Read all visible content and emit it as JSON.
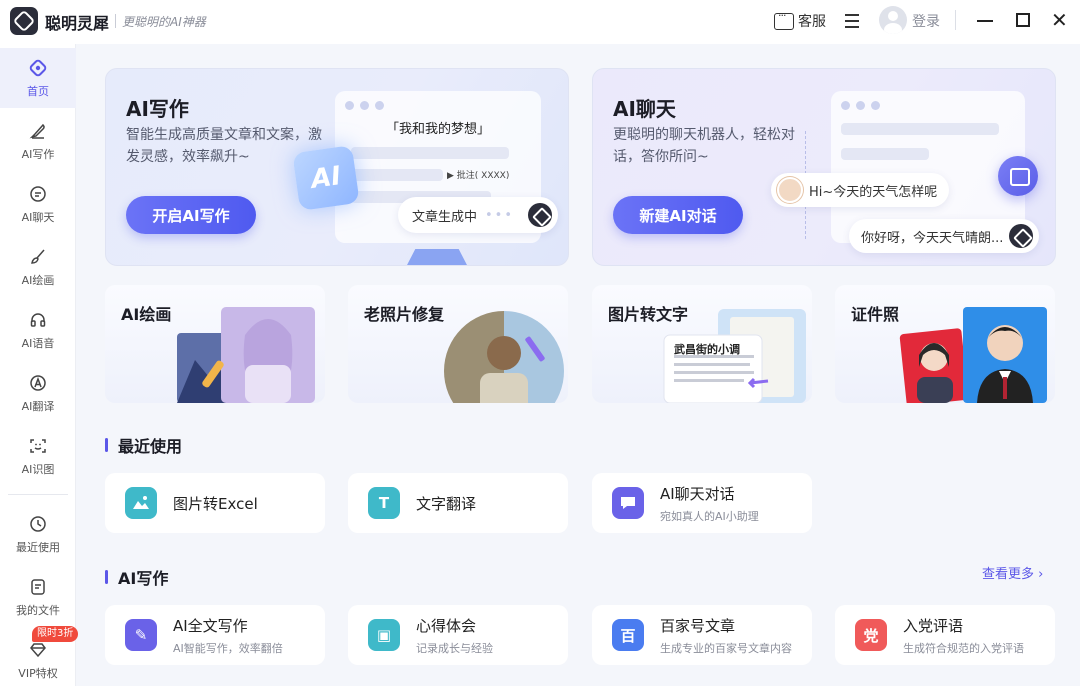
{
  "app": {
    "name": "聪明灵犀",
    "slogan": "更聪明的AI神器"
  },
  "titlebar": {
    "service": "客服",
    "login": "登录"
  },
  "sidebar": {
    "items": [
      {
        "label": "首页",
        "icon": "home-icon"
      },
      {
        "label": "AI写作",
        "icon": "pen-icon"
      },
      {
        "label": "AI聊天",
        "icon": "chat-icon"
      },
      {
        "label": "AI绘画",
        "icon": "brush-icon"
      },
      {
        "label": "AI语音",
        "icon": "headphones-icon"
      },
      {
        "label": "AI翻译",
        "icon": "translate-icon"
      },
      {
        "label": "AI识图",
        "icon": "scan-icon"
      },
      {
        "label": "最近使用",
        "icon": "clock-icon"
      },
      {
        "label": "我的文件",
        "icon": "file-icon"
      },
      {
        "label": "VIP特权",
        "icon": "diamond-icon"
      }
    ],
    "vip_badge": "限时3折"
  },
  "hero_write": {
    "title": "AI写作",
    "desc": "智能生成高质量文章和文案，激发灵感，效率飙升~",
    "button": "开启AI写作",
    "doc_title": "「我和我的梦想」",
    "doc_note": "▶ 批注( XXXX)",
    "ai_badge": "AI",
    "status": "文章生成中"
  },
  "hero_chat": {
    "title": "AI聊天",
    "desc": "更聪明的聊天机器人，轻松对话，答你所问~",
    "button": "新建AI对话",
    "bubble_user": "Hi~今天的天气怎样呢",
    "bubble_bot": "你好呀，今天天气晴朗..."
  },
  "features": [
    {
      "title": "AI绘画"
    },
    {
      "title": "老照片修复"
    },
    {
      "title": "图片转文字",
      "sample_title": "武昌街的小调"
    },
    {
      "title": "证件照"
    }
  ],
  "recent": {
    "title": "最近使用",
    "items": [
      {
        "title": "图片转Excel",
        "subtitle": "",
        "color": "#3fb9c9"
      },
      {
        "title": "文字翻译",
        "subtitle": "",
        "color": "#3fb9c9"
      },
      {
        "title": "AI聊天对话",
        "subtitle": "宛如真人的AI小助理",
        "color": "#6a62e8"
      }
    ]
  },
  "writing": {
    "title": "AI写作",
    "more": "查看更多 ›",
    "items": [
      {
        "title": "AI全文写作",
        "subtitle": "AI智能写作，效率翻倍",
        "color": "#6a62e8",
        "glyph": "✎"
      },
      {
        "title": "心得体会",
        "subtitle": "记录成长与经验",
        "color": "#3fb9c9",
        "glyph": "▣"
      },
      {
        "title": "百家号文章",
        "subtitle": "生成专业的百家号文章内容",
        "color": "#4a7cf0",
        "glyph": "百"
      },
      {
        "title": "入党评语",
        "subtitle": "生成符合规范的入党评语",
        "color": "#f05a5a",
        "glyph": "党"
      }
    ]
  }
}
